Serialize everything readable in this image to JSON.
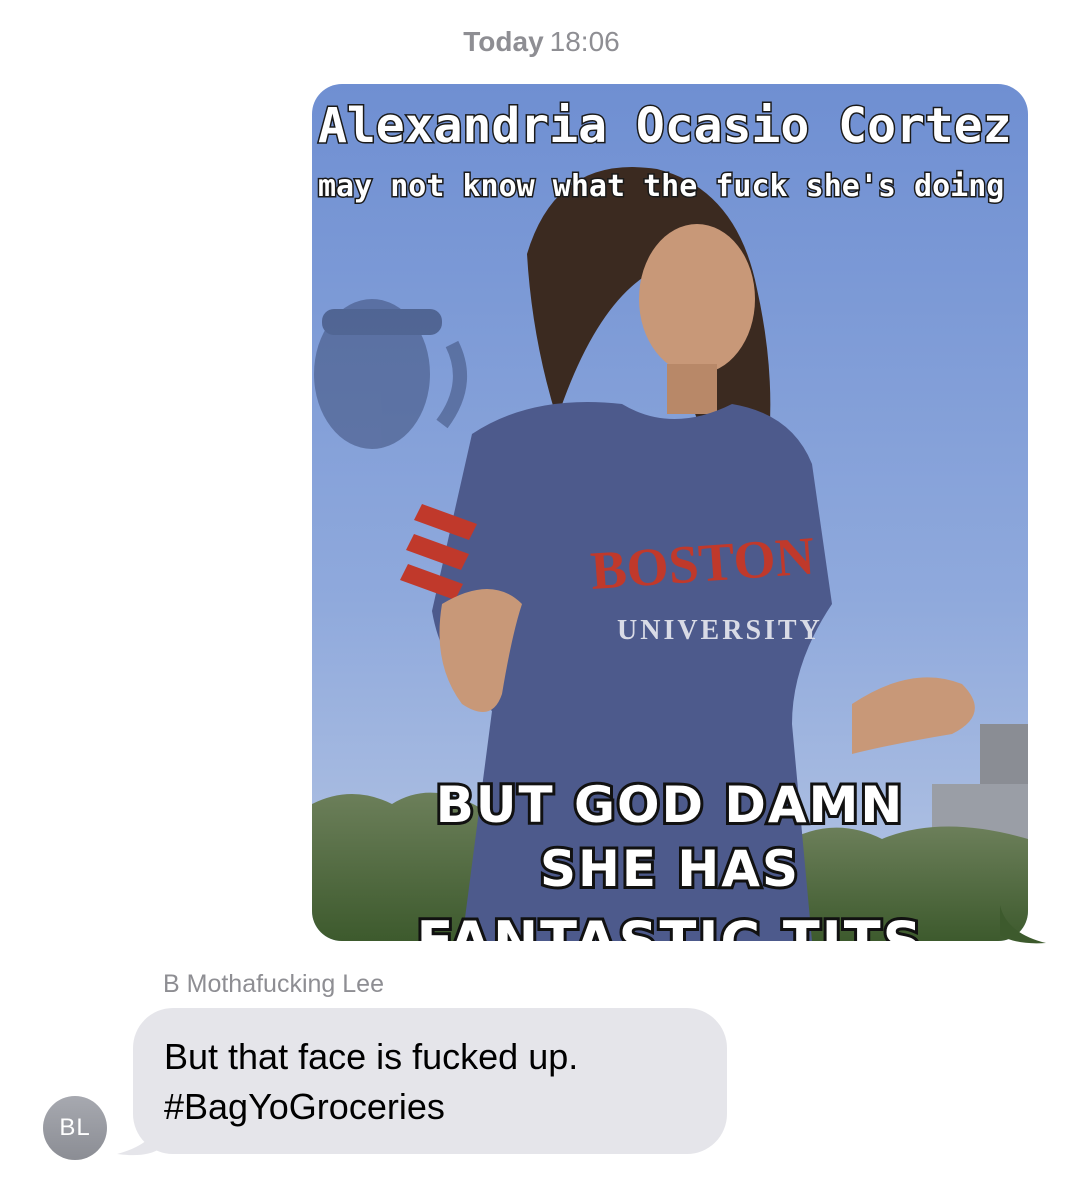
{
  "conversation": {
    "timestamp_day": "Today",
    "timestamp_time": "18:06"
  },
  "image_message": {
    "caption_top_line1": "Alexandria Ocasio Cortez",
    "caption_top_line2": "may not know what the fuck she's doing",
    "shirt_text_line1": "BOSTON",
    "shirt_text_line2": "UNIVERSITY",
    "caption_bottom_line1": "BUT GOD DAMN",
    "caption_bottom_line2": "SHE HAS",
    "caption_bottom_line3": "FANTASTIC TITS",
    "colors": {
      "sky": "#7b9ad6",
      "shirt": "#4d5a8c",
      "shirt_stripe": "#c0392b",
      "trees": "#4f6b3c"
    }
  },
  "incoming": {
    "sender_name": "B Mothafucking Lee",
    "line1": "But that face is fucked up.",
    "line2": "#BagYoGroceries",
    "avatar_initials": "BL",
    "bubble_color": "#e5e5ea"
  }
}
